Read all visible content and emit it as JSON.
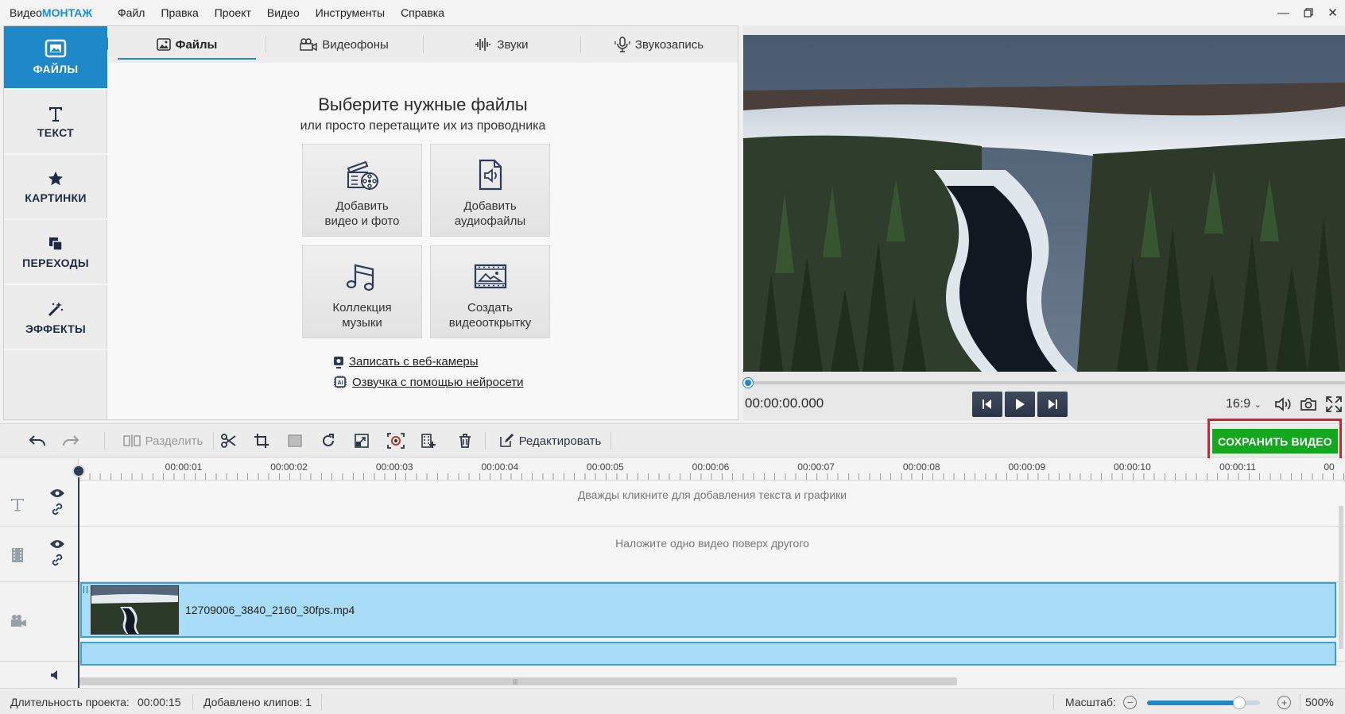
{
  "app": {
    "title_prefix": "Видео",
    "title_accent": "МОНТАЖ"
  },
  "menu": [
    "Файл",
    "Правка",
    "Проект",
    "Видео",
    "Инструменты",
    "Справка"
  ],
  "sidebar": {
    "items": [
      {
        "label": "ФАЙЛЫ",
        "icon": "image-icon",
        "active": true
      },
      {
        "label": "ТЕКСТ",
        "icon": "text-icon"
      },
      {
        "label": "КАРТИНКИ",
        "icon": "star-icon"
      },
      {
        "label": "ПЕРЕХОДЫ",
        "icon": "transitions-icon"
      },
      {
        "label": "ЭФФЕКТЫ",
        "icon": "magic-wand-icon"
      }
    ]
  },
  "tabs": [
    {
      "label": "Файлы",
      "icon": "image-icon",
      "active": true
    },
    {
      "label": "Видеофоны",
      "icon": "video-background-icon"
    },
    {
      "label": "Звуки",
      "icon": "waveform-icon"
    },
    {
      "label": "Звукозапись",
      "icon": "microphone-icon"
    }
  ],
  "files": {
    "heading": "Выберите нужные файлы",
    "subheading": "или просто перетащите их из проводника",
    "tiles": [
      {
        "line1": "Добавить",
        "line2": "видео и фото",
        "icon": "film-reel-icon"
      },
      {
        "line1": "Добавить",
        "line2": "аудиофайлы",
        "icon": "audio-file-icon"
      },
      {
        "line1": "Коллекция",
        "line2": "музыки",
        "icon": "music-notes-icon"
      },
      {
        "line1": "Создать",
        "line2": "видеооткрытку",
        "icon": "postcard-icon"
      }
    ],
    "links": [
      {
        "label": "Записать с веб-камеры",
        "icon": "webcam-icon"
      },
      {
        "label": "Озвучка с помощью нейросети",
        "icon": "ai-chip-icon"
      }
    ]
  },
  "preview": {
    "timecode": "00:00:00.000",
    "aspect": "16:9",
    "progress": 0
  },
  "toolbar": {
    "split_label": "Разделить",
    "edit_label": "Редактировать",
    "save_label": "СОХРАНИТЬ ВИДЕО"
  },
  "timeline": {
    "ticks": [
      "00:00:01",
      "00:00:02",
      "00:00:03",
      "00:00:04",
      "00:00:05",
      "00:00:06",
      "00:00:07",
      "00:00:08",
      "00:00:09",
      "00:00:10",
      "00:00:11",
      "00"
    ],
    "text_lane_hint": "Дважды кликните для добавления текста и графики",
    "overlay_lane_hint": "Наложите одно видео поверх другого",
    "clip_name": "12709006_3840_2160_30fps.mp4"
  },
  "status": {
    "duration_label": "Длительность проекта:",
    "duration_value": "00:00:15",
    "clips_label": "Добавлено клипов: 1",
    "zoom_label": "Масштаб:",
    "zoom_value": "500%",
    "zoom_level": 0.82
  },
  "colors": {
    "accent": "#1f88c8",
    "save_button": "#14a81f",
    "highlight": "#e31b23",
    "clip": "#a9dcf7"
  }
}
